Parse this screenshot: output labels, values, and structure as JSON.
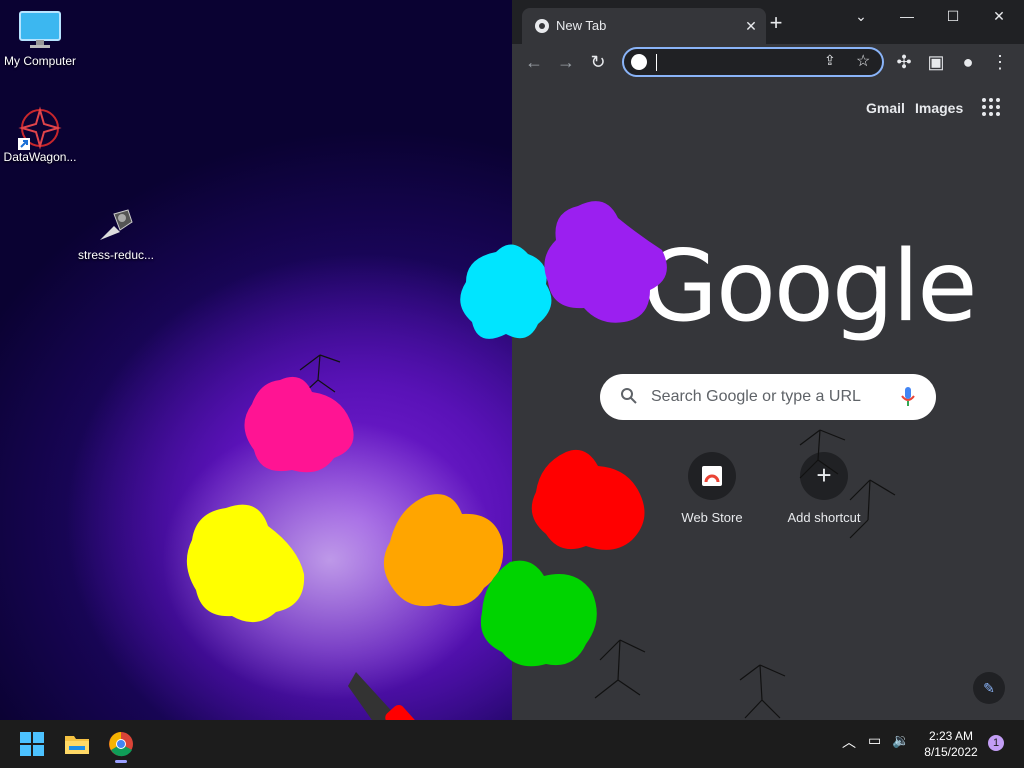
{
  "desktop": {
    "icons": [
      {
        "label": "My Computer",
        "icon": "monitor-icon"
      },
      {
        "label": "DataWagon...",
        "icon": "datawagon-icon"
      },
      {
        "label": "stress-reduc...",
        "icon": "stress-reducer-icon"
      }
    ]
  },
  "browser": {
    "tab": {
      "title": "New Tab",
      "favicon": "chrome-icon"
    },
    "window_controls": [
      "chevron-down-icon",
      "minimize-icon",
      "maximize-icon",
      "close-icon"
    ],
    "omnibox": {
      "value": ""
    },
    "toplinks": {
      "gmail": "Gmail",
      "images": "Images"
    },
    "logo": "Google",
    "search": {
      "placeholder": "Search Google or type a URL"
    },
    "shortcuts": [
      {
        "label": "Web Store",
        "icon": "web-store-icon"
      },
      {
        "label": "Add shortcut",
        "icon": "plus-icon"
      }
    ],
    "colors": {
      "accent": "#8ab4f8",
      "page_bg": "#35363a",
      "frame": "#202124"
    }
  },
  "taskbar": {
    "apps": [
      "windows-start-icon",
      "file-explorer-icon",
      "chrome-icon"
    ],
    "time": "2:23 AM",
    "date": "8/15/2022",
    "notification_count": "1"
  },
  "splats": [
    {
      "color": "#00e5ff"
    },
    {
      "color": "#9b1ff0"
    },
    {
      "color": "#ff1493"
    },
    {
      "color": "#ff0000"
    },
    {
      "color": "#ffff00"
    },
    {
      "color": "#ffa500"
    },
    {
      "color": "#00d400"
    }
  ]
}
